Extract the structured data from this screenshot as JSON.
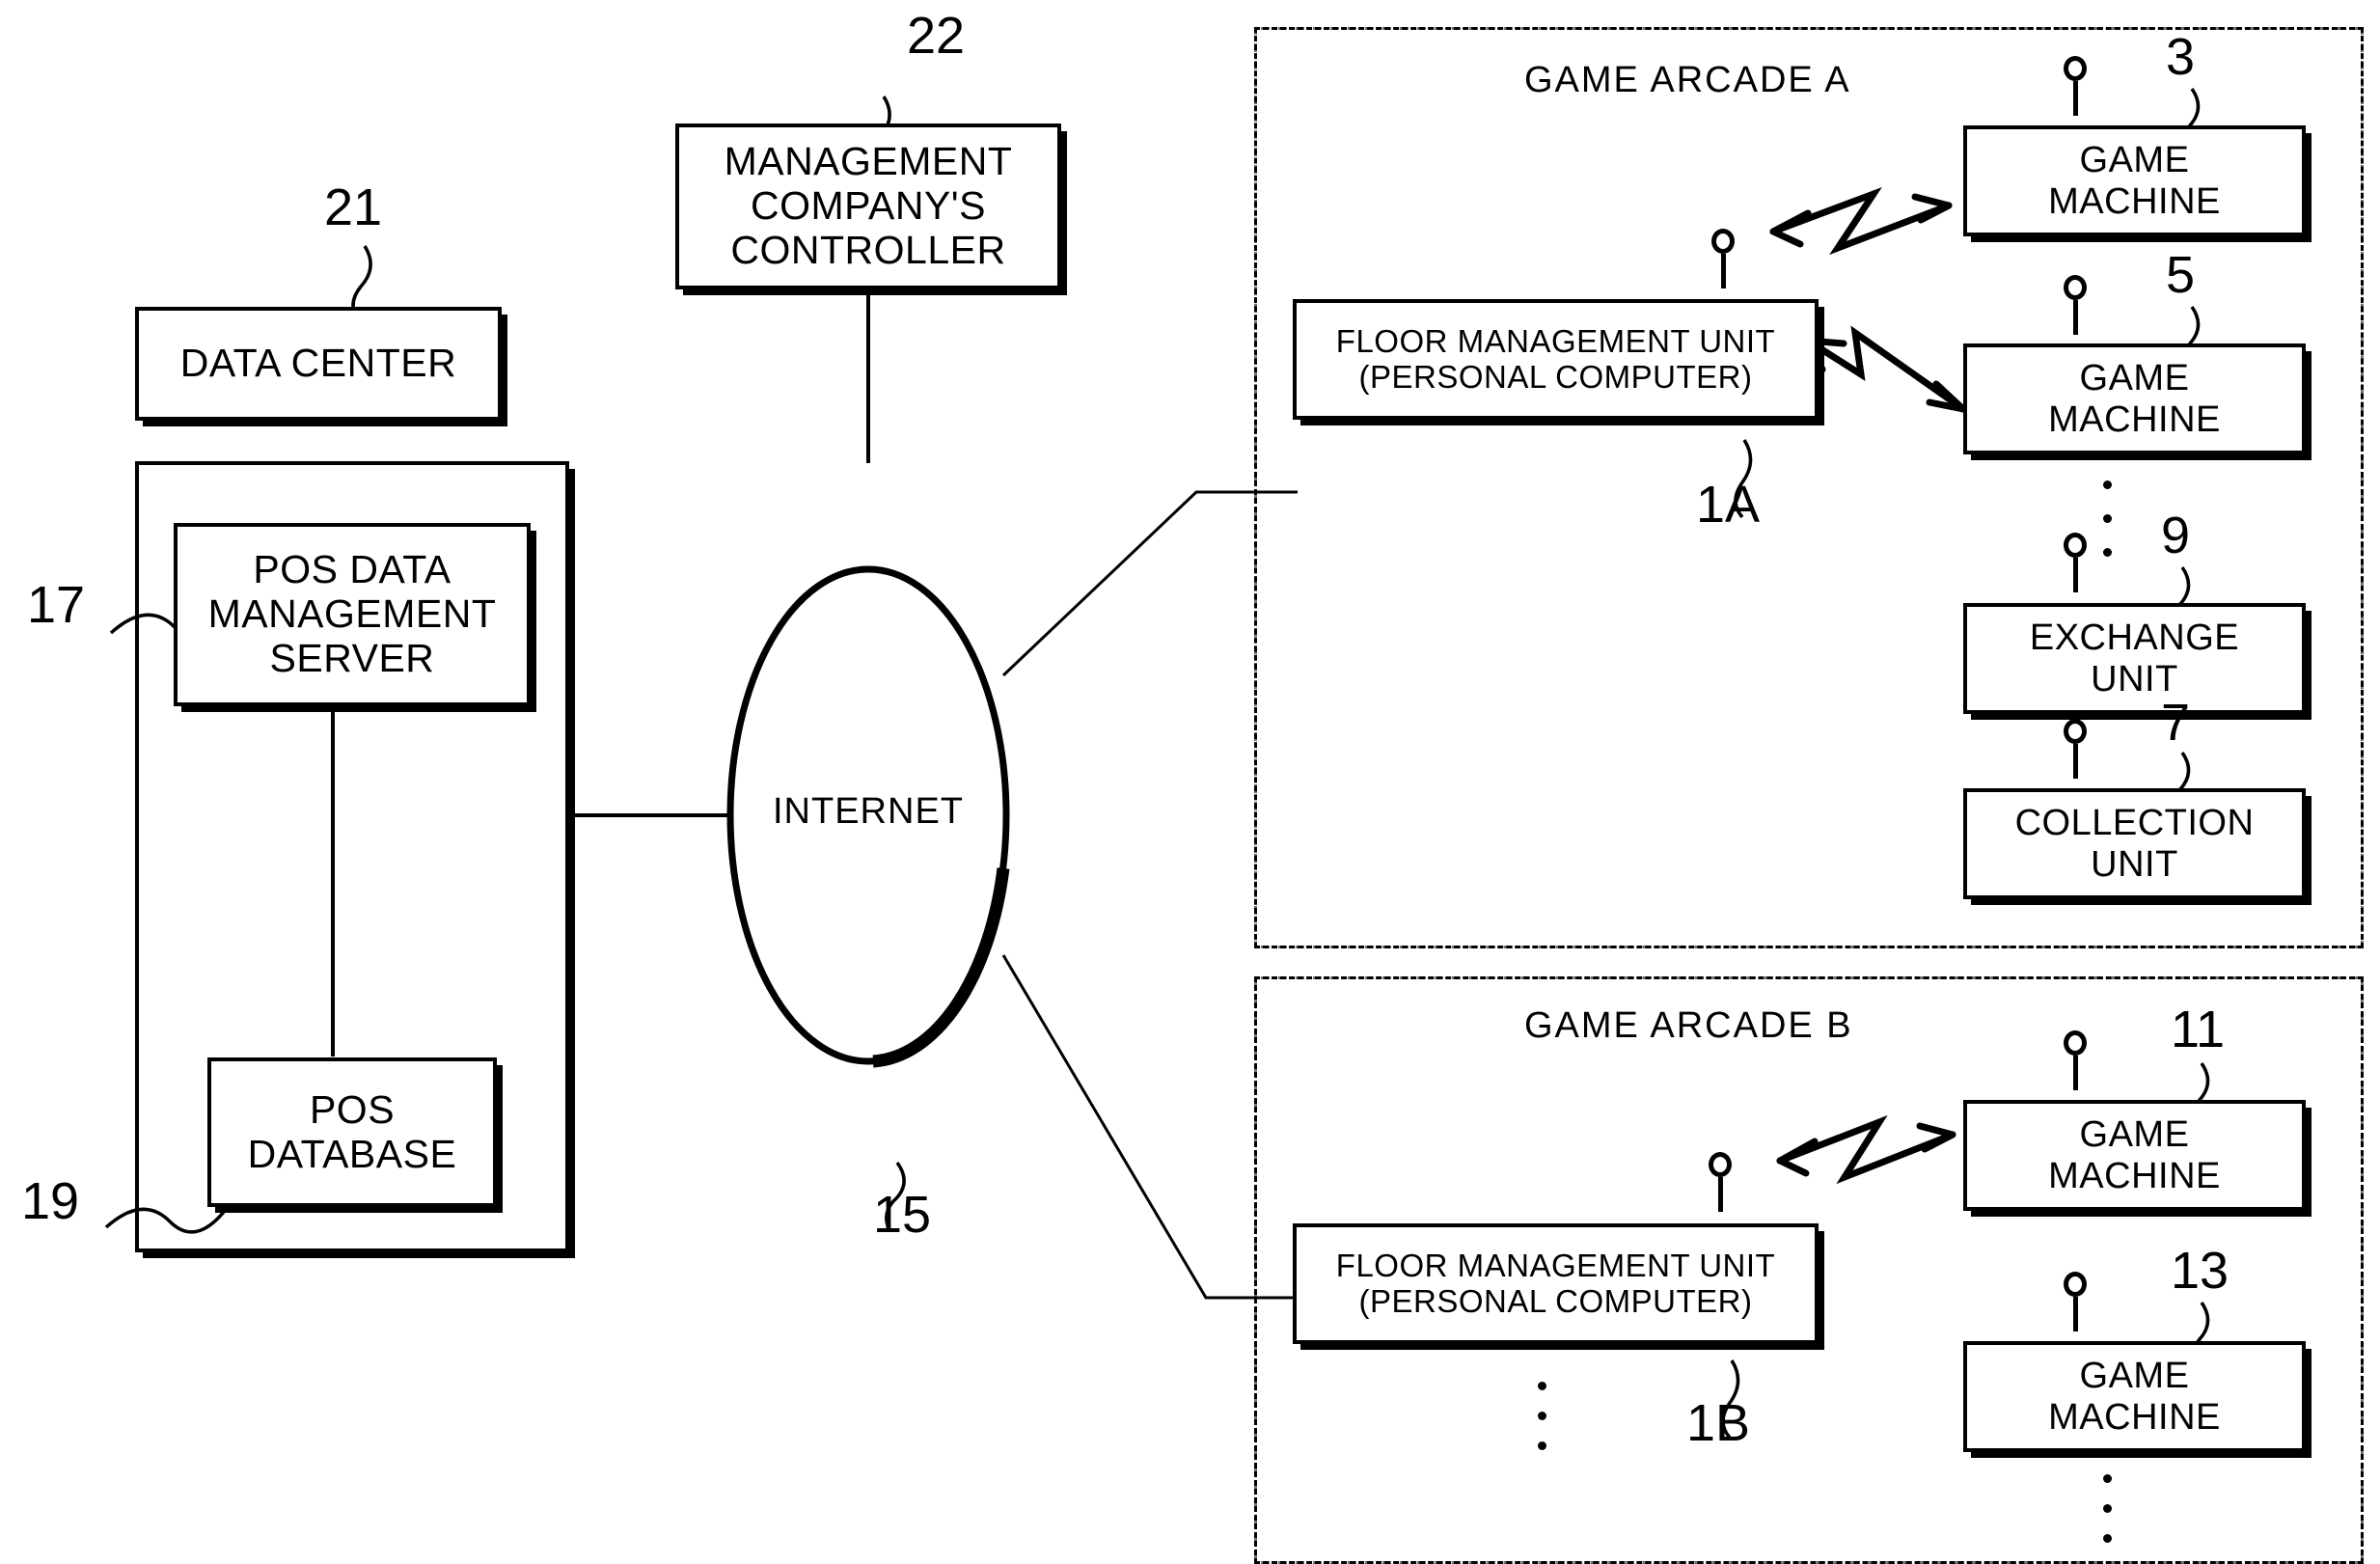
{
  "figure": {
    "type": "patent-system-block-diagram",
    "title": "Game arcade POS data management network"
  },
  "left": {
    "data_center": {
      "label": "DATA CENTER",
      "ref": "21"
    },
    "pos_server": {
      "label": "POS  DATA\nMANAGEMENT\nSERVER",
      "ref": "17"
    },
    "pos_database": {
      "label": "POS\nDATABASE",
      "ref": "19"
    }
  },
  "center": {
    "controller": {
      "label": "MANAGEMENT\nCOMPANY'S\nCONTROLLER",
      "ref": "22"
    },
    "internet": {
      "label": "INTERNET",
      "ref": "15"
    }
  },
  "arcade_a": {
    "title": "GAME ARCADE A",
    "floor_unit": {
      "label": "FLOOR MANAGEMENT UNIT\n(PERSONAL COMPUTER)",
      "ref": "1A"
    },
    "nodes": [
      {
        "label": "GAME\nMACHINE",
        "ref": "3"
      },
      {
        "label": "GAME\nMACHINE",
        "ref": "5"
      },
      {
        "label": "EXCHANGE\nUNIT",
        "ref": "9"
      },
      {
        "label": "COLLECTION\nUNIT",
        "ref": "7"
      }
    ]
  },
  "arcade_b": {
    "title": "GAME ARCADE B",
    "floor_unit": {
      "label": "FLOOR MANAGEMENT UNIT\n(PERSONAL COMPUTER)",
      "ref": "1B"
    },
    "nodes": [
      {
        "label": "GAME\nMACHINE",
        "ref": "11"
      },
      {
        "label": "GAME\nMACHINE",
        "ref": "13"
      }
    ]
  },
  "colors": {
    "ink": "#000000",
    "paper": "#ffffff"
  }
}
